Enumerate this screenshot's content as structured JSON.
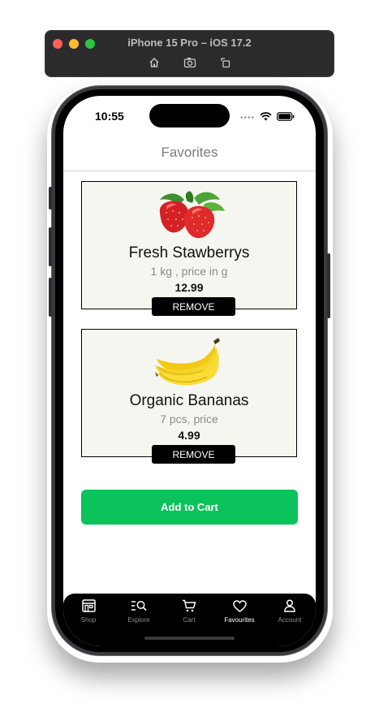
{
  "simulator": {
    "title": "iPhone 15 Pro – iOS 17.2",
    "tools": [
      "home-icon",
      "screenshot-icon",
      "rotate-icon"
    ]
  },
  "status_bar": {
    "time": "10:55",
    "indicators": "••••"
  },
  "header": {
    "title": "Favorites"
  },
  "favorites": [
    {
      "name": "Fresh Stawberrys",
      "description": "1 kg , price in g",
      "price": "12.99",
      "remove_label": "REMOVE",
      "icon": "strawberry-image"
    },
    {
      "name": "Organic Bananas",
      "description": "7 pcs, price",
      "price": "4.99",
      "remove_label": "REMOVE",
      "icon": "banana-image"
    }
  ],
  "add_to_cart_label": "Add to Cart",
  "tabbar": {
    "items": [
      {
        "label": "Shop",
        "icon": "store-icon",
        "active": false
      },
      {
        "label": "Explore",
        "icon": "explore-icon",
        "active": false
      },
      {
        "label": "Cart",
        "icon": "cart-icon",
        "active": false
      },
      {
        "label": "Favourites",
        "icon": "heart-icon",
        "active": true
      },
      {
        "label": "Account",
        "icon": "account-icon",
        "active": false
      }
    ]
  },
  "colors": {
    "accent": "#0ac35a",
    "card_bg": "#f6f6f0",
    "tabbar_bg": "#000000"
  }
}
